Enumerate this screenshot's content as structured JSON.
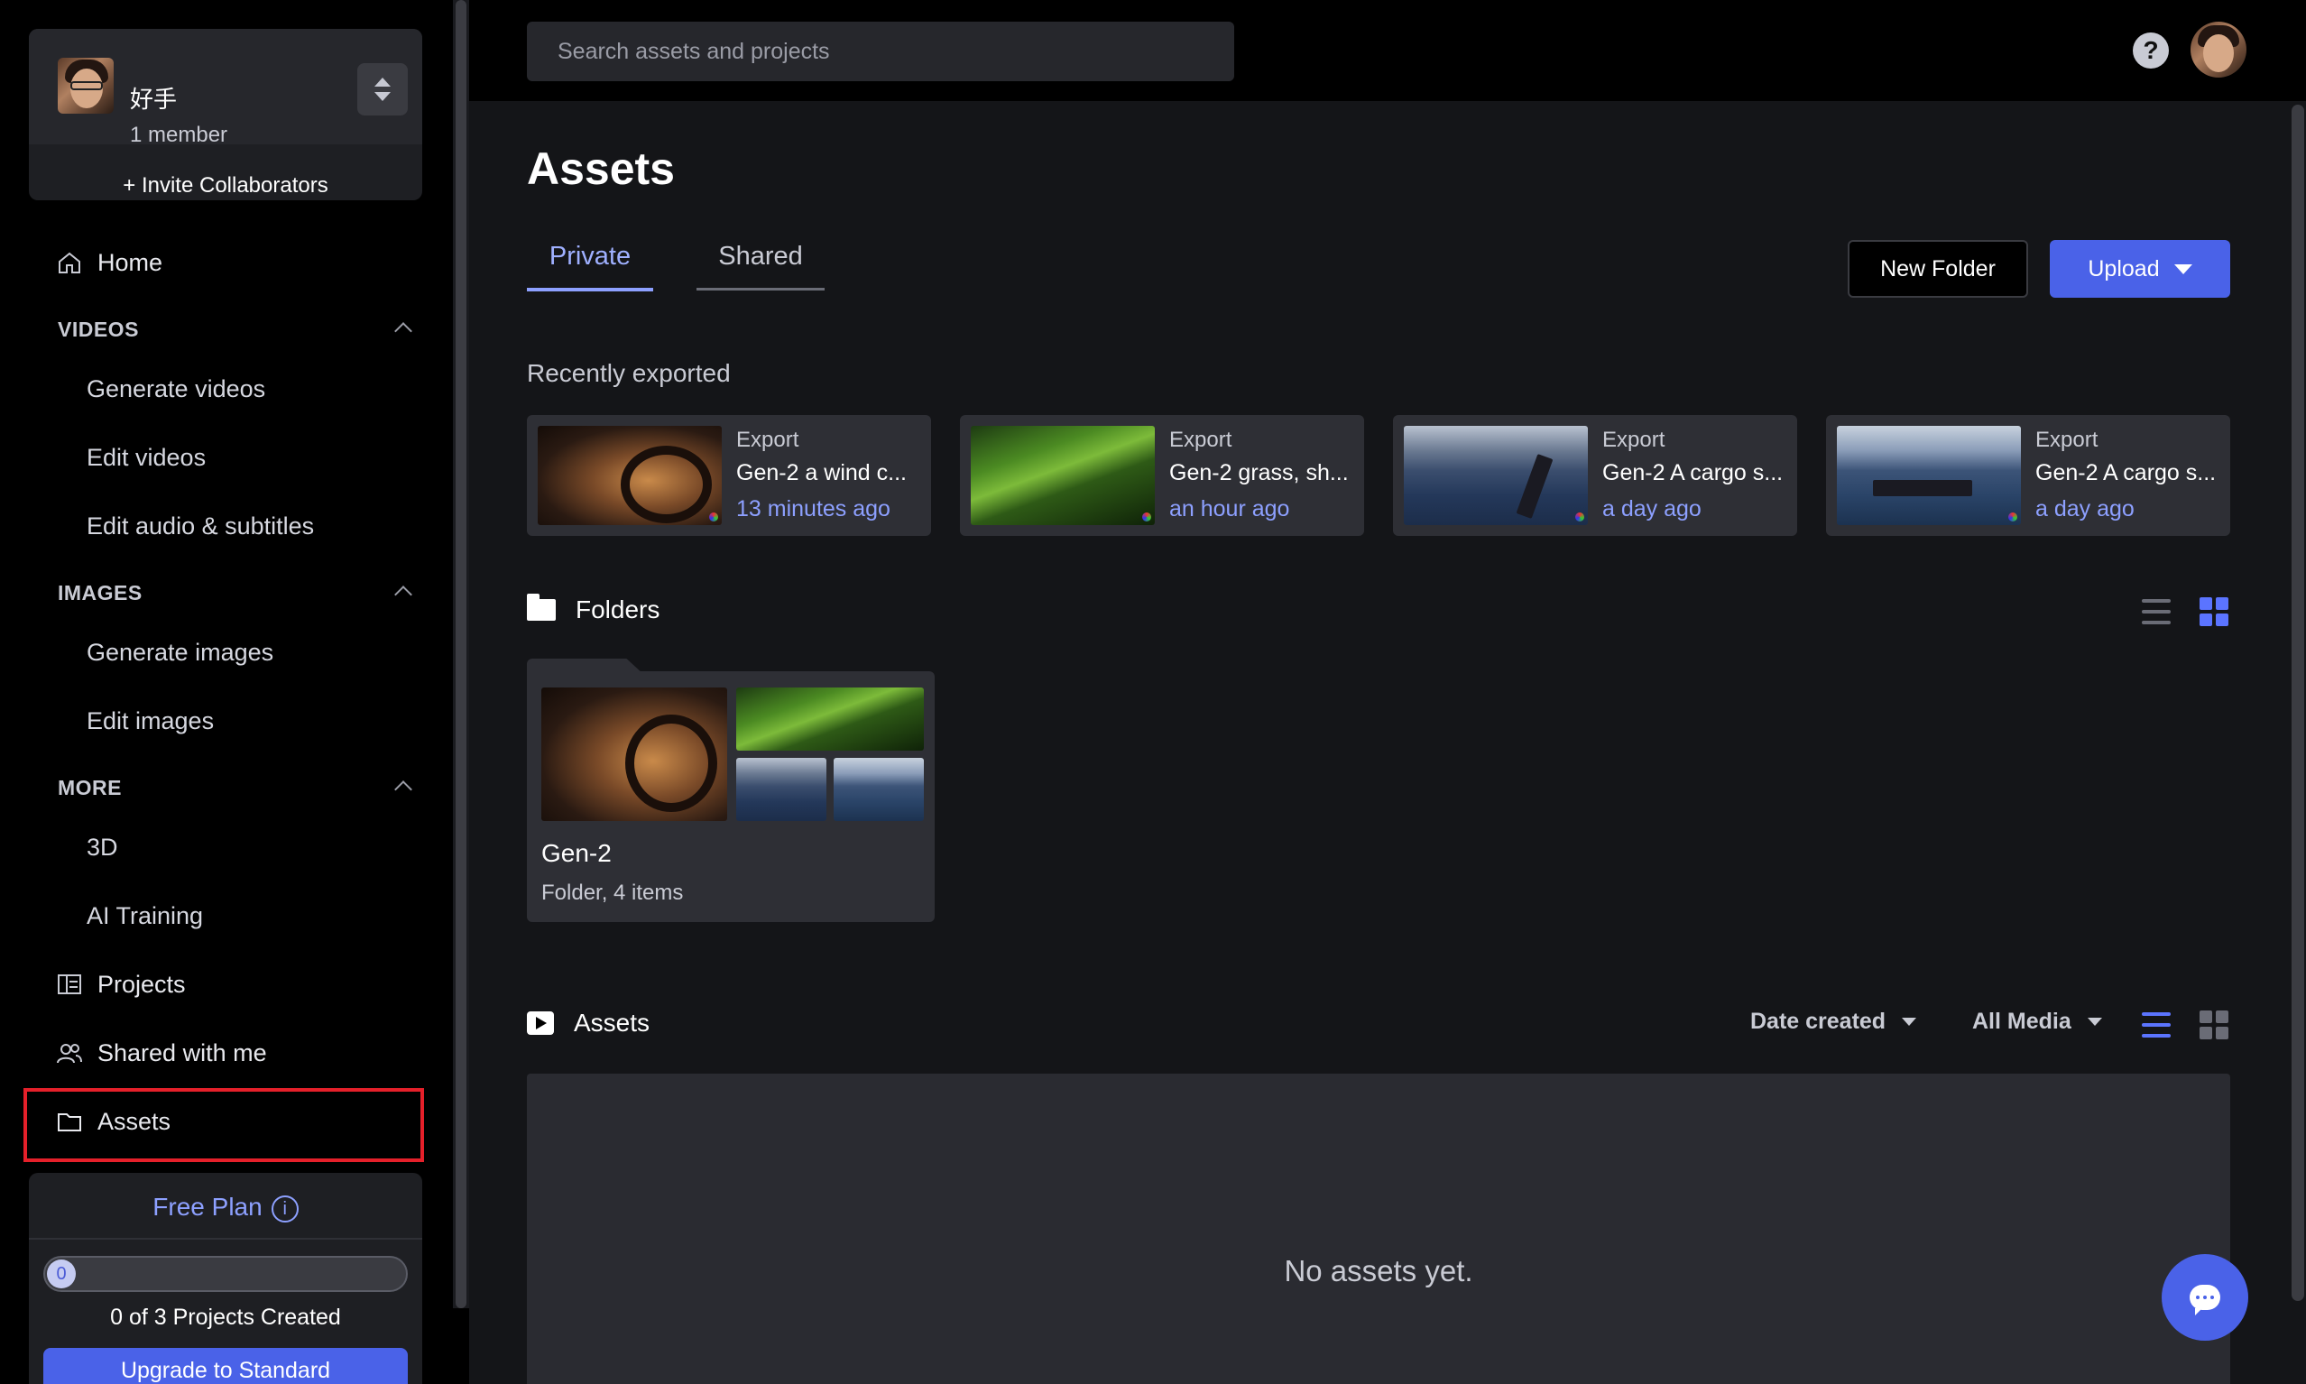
{
  "workspace": {
    "name": "好手",
    "members": "1 member",
    "invite": "+ Invite Collaborators"
  },
  "nav": {
    "home": "Home",
    "videos_section": "VIDEOS",
    "generate_videos": "Generate videos",
    "edit_videos": "Edit videos",
    "edit_audio": "Edit audio & subtitles",
    "images_section": "IMAGES",
    "generate_images": "Generate images",
    "edit_images": "Edit images",
    "more_section": "MORE",
    "three_d": "3D",
    "ai_training": "AI Training",
    "projects": "Projects",
    "shared_with_me": "Shared with me",
    "assets": "Assets"
  },
  "plan": {
    "label": "Free Plan",
    "info": "i",
    "progress_value": "0",
    "progress_fraction": 0,
    "projects_created": "0 of 3 Projects Created",
    "upgrade": "Upgrade to Standard"
  },
  "header": {
    "search_placeholder": "Search assets and projects",
    "help": "?"
  },
  "page": {
    "title": "Assets"
  },
  "tabs": {
    "private": "Private",
    "shared": "Shared",
    "active": "Private"
  },
  "buttons": {
    "new_folder": "New Folder",
    "upload": "Upload"
  },
  "recent": {
    "label": "Recently exported",
    "items": [
      {
        "kind": "Export",
        "name": "Gen-2 a wind c...",
        "time": "13 minutes ago"
      },
      {
        "kind": "Export",
        "name": "Gen-2 grass, sh...",
        "time": "an hour ago"
      },
      {
        "kind": "Export",
        "name": "Gen-2 A cargo s...",
        "time": "a day ago"
      },
      {
        "kind": "Export",
        "name": "Gen-2 A cargo s...",
        "time": "a day ago"
      }
    ]
  },
  "folders": {
    "label": "Folders",
    "view_active": "grid",
    "items": [
      {
        "name": "Gen-2",
        "meta": "Folder, 4 items"
      }
    ]
  },
  "assets": {
    "label": "Assets",
    "sort": "Date created",
    "filter": "All Media",
    "view_active": "list",
    "empty": "No assets yet."
  },
  "colors": {
    "accent": "#4a62e8",
    "accent_text": "#8da0ff",
    "highlight_border": "#e5202a"
  }
}
